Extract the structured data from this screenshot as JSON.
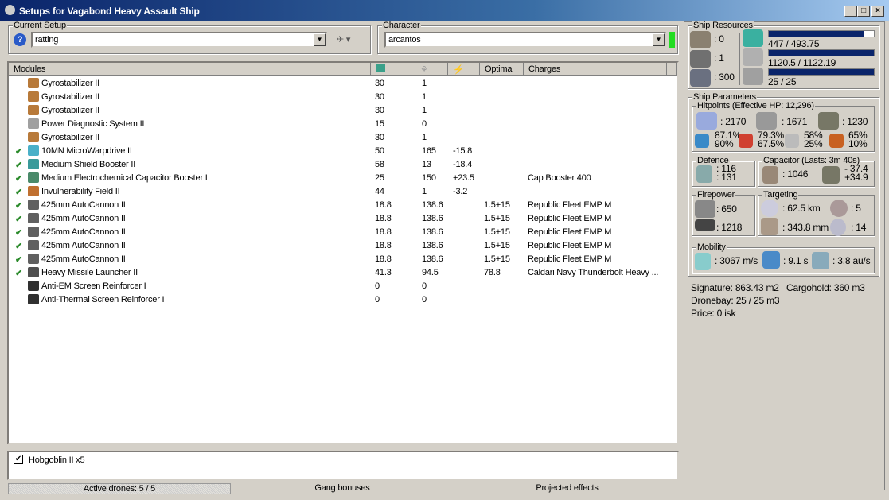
{
  "window": {
    "title": "Setups for Vagabond Heavy Assault Ship",
    "min": "_",
    "max": "□",
    "close": "×"
  },
  "setup": {
    "label": "Current Setup",
    "value": "ratting"
  },
  "character": {
    "label": "Character",
    "value": "arcantos"
  },
  "columns": [
    "Modules",
    "",
    "",
    "",
    "Optimal",
    "Charges"
  ],
  "modules": [
    {
      "on": false,
      "name": "Gyrostabilizer II",
      "c1": "30",
      "c2": "1",
      "c3": "",
      "opt": "",
      "charge": "",
      "color": "#b87a3a"
    },
    {
      "on": false,
      "name": "Gyrostabilizer II",
      "c1": "30",
      "c2": "1",
      "c3": "",
      "opt": "",
      "charge": "",
      "color": "#b87a3a"
    },
    {
      "on": false,
      "name": "Gyrostabilizer II",
      "c1": "30",
      "c2": "1",
      "c3": "",
      "opt": "",
      "charge": "",
      "color": "#b87a3a"
    },
    {
      "on": false,
      "name": "Power Diagnostic System II",
      "c1": "15",
      "c2": "0",
      "c3": "",
      "opt": "",
      "charge": "",
      "color": "#a0a0a0"
    },
    {
      "on": false,
      "name": "Gyrostabilizer II",
      "c1": "30",
      "c2": "1",
      "c3": "",
      "opt": "",
      "charge": "",
      "color": "#b87a3a"
    },
    {
      "on": true,
      "name": "10MN MicroWarpdrive II",
      "c1": "50",
      "c2": "165",
      "c3": "-15.8",
      "opt": "",
      "charge": "",
      "color": "#4ab0c8"
    },
    {
      "on": true,
      "name": "Medium Shield Booster II",
      "c1": "58",
      "c2": "13",
      "c3": "-18.4",
      "opt": "",
      "charge": "",
      "color": "#3a9a9a"
    },
    {
      "on": true,
      "name": "Medium Electrochemical Capacitor Booster I",
      "c1": "25",
      "c2": "150",
      "c3": "+23.5",
      "opt": "",
      "charge": "Cap Booster 400",
      "color": "#4a8a6a"
    },
    {
      "on": true,
      "name": "Invulnerability Field II",
      "c1": "44",
      "c2": "1",
      "c3": "-3.2",
      "opt": "",
      "charge": "",
      "color": "#c07030"
    },
    {
      "on": true,
      "name": "425mm AutoCannon II",
      "c1": "18.8",
      "c2": "138.6",
      "c3": "",
      "opt": "1.5+15",
      "charge": "Republic Fleet EMP M",
      "color": "#606060"
    },
    {
      "on": true,
      "name": "425mm AutoCannon II",
      "c1": "18.8",
      "c2": "138.6",
      "c3": "",
      "opt": "1.5+15",
      "charge": "Republic Fleet EMP M",
      "color": "#606060"
    },
    {
      "on": true,
      "name": "425mm AutoCannon II",
      "c1": "18.8",
      "c2": "138.6",
      "c3": "",
      "opt": "1.5+15",
      "charge": "Republic Fleet EMP M",
      "color": "#606060"
    },
    {
      "on": true,
      "name": "425mm AutoCannon II",
      "c1": "18.8",
      "c2": "138.6",
      "c3": "",
      "opt": "1.5+15",
      "charge": "Republic Fleet EMP M",
      "color": "#606060"
    },
    {
      "on": true,
      "name": "425mm AutoCannon II",
      "c1": "18.8",
      "c2": "138.6",
      "c3": "",
      "opt": "1.5+15",
      "charge": "Republic Fleet EMP M",
      "color": "#606060"
    },
    {
      "on": true,
      "name": "Heavy Missile Launcher II",
      "c1": "41.3",
      "c2": "94.5",
      "c3": "",
      "opt": "78.8",
      "charge": "Caldari Navy Thunderbolt Heavy ...",
      "color": "#505050"
    },
    {
      "on": false,
      "name": "Anti-EM Screen Reinforcer I",
      "c1": "0",
      "c2": "0",
      "c3": "",
      "opt": "",
      "charge": "",
      "color": "#303030"
    },
    {
      "on": false,
      "name": "Anti-Thermal Screen Reinforcer I",
      "c1": "0",
      "c2": "0",
      "c3": "",
      "opt": "",
      "charge": "",
      "color": "#303030"
    }
  ],
  "drones": {
    "item": "Hobgoblin II x5",
    "checked": true
  },
  "bottom_tabs": [
    "Active drones: 5 / 5",
    "Gang bonuses",
    "Projected effects"
  ],
  "resources": {
    "label": "Ship Resources",
    "turret": ": 0",
    "launcher": ": 1",
    "calib": ": 300",
    "cpu": {
      "text": "447 / 493.75",
      "fraction": 0.905
    },
    "pg": {
      "text": "1120.5 / 1122.19",
      "fraction": 0.998
    },
    "drone_bw": {
      "text": "25 / 25",
      "fraction": 1.0
    }
  },
  "params": {
    "label": "Ship Parameters",
    "hp_label": "Hitpoints (Effective HP: 12,296)",
    "shield": ": 2170",
    "armor": ": 1671",
    "hull": ": 1230",
    "res": [
      [
        "87.1%",
        "90%"
      ],
      [
        "79.3%",
        "67.5%"
      ],
      [
        "58%",
        "25%"
      ],
      [
        "65%",
        "10%"
      ]
    ],
    "defence_label": "Defence",
    "def1": ": 116",
    "def2": ": 131",
    "cap_label": "Capacitor (Lasts: 3m 40s)",
    "cap": ": 1046",
    "cap_use": "- 37.4",
    "cap_regen": "+34.9",
    "fire_label": "Firepower",
    "dps": ": 650",
    "volley": ": 1218",
    "target_label": "Targeting",
    "range": ": 62.5 km",
    "maxtgt": ": 5",
    "sigres": ": 343.8 mm",
    "scan": ": 14",
    "mob_label": "Mobility",
    "speed": ": 3067 m/s",
    "align": ": 9.1 s",
    "warp": ": 3.8 au/s",
    "signature": "Signature: 863.43 m2",
    "cargo": "Cargohold: 360 m3",
    "dronebay": "Dronebay: 25 / 25 m3",
    "price": "Price: 0 isk"
  }
}
